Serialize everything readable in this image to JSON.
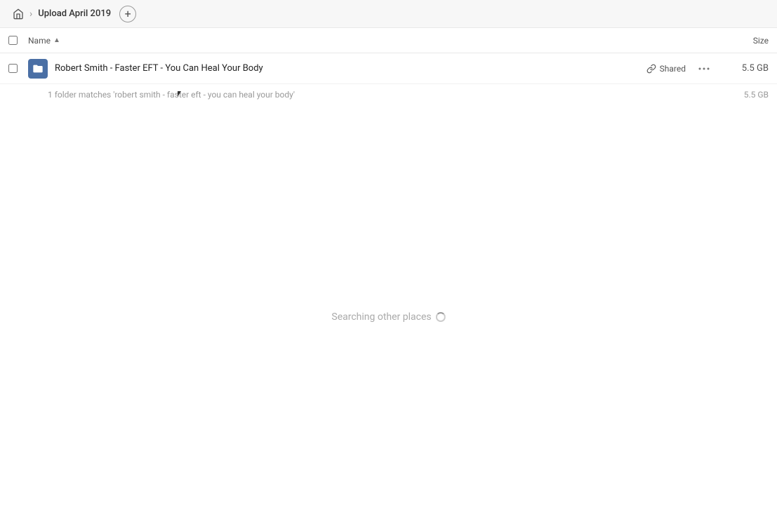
{
  "toolbar": {
    "home_label": "Home",
    "breadcrumb_label": "Upload April 2019",
    "add_button_label": "+"
  },
  "columns": {
    "name_label": "Name",
    "sort_icon": "▲",
    "size_label": "Size"
  },
  "file_row": {
    "name": "Robert Smith - Faster EFT - You Can Heal Your Body",
    "shared_label": "Shared",
    "more_icon": "···",
    "size": "5.5 GB"
  },
  "match_info": {
    "text": "1 folder matches 'robert smith - faster eft - you can heal your body'",
    "size": "5.5 GB"
  },
  "searching": {
    "label": "Searching other places"
  },
  "icons": {
    "home": "🏠",
    "link": "🔗",
    "folder": "folder"
  }
}
